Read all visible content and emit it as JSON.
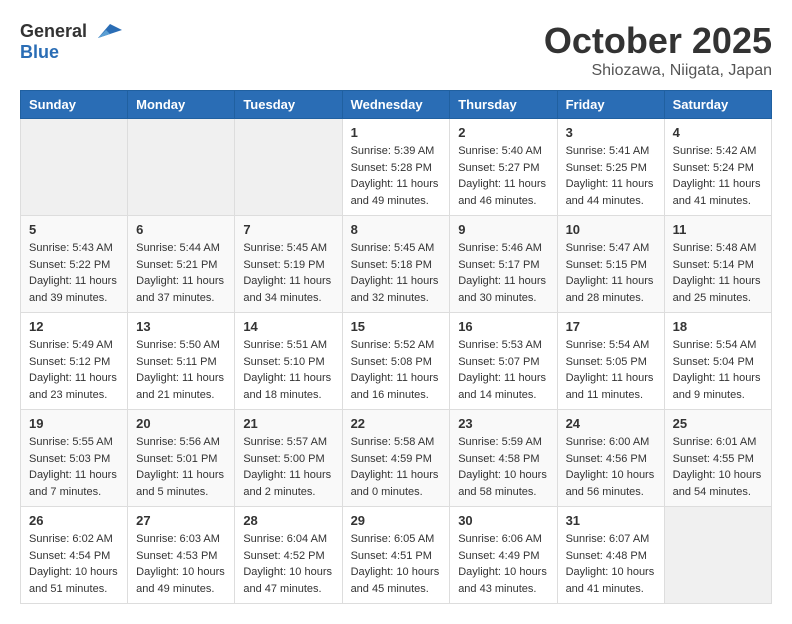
{
  "header": {
    "logo_general": "General",
    "logo_blue": "Blue",
    "month": "October 2025",
    "location": "Shiozawa, Niigata, Japan"
  },
  "days_of_week": [
    "Sunday",
    "Monday",
    "Tuesday",
    "Wednesday",
    "Thursday",
    "Friday",
    "Saturday"
  ],
  "weeks": [
    [
      {
        "day": "",
        "info": ""
      },
      {
        "day": "",
        "info": ""
      },
      {
        "day": "",
        "info": ""
      },
      {
        "day": "1",
        "info": "Sunrise: 5:39 AM\nSunset: 5:28 PM\nDaylight: 11 hours\nand 49 minutes."
      },
      {
        "day": "2",
        "info": "Sunrise: 5:40 AM\nSunset: 5:27 PM\nDaylight: 11 hours\nand 46 minutes."
      },
      {
        "day": "3",
        "info": "Sunrise: 5:41 AM\nSunset: 5:25 PM\nDaylight: 11 hours\nand 44 minutes."
      },
      {
        "day": "4",
        "info": "Sunrise: 5:42 AM\nSunset: 5:24 PM\nDaylight: 11 hours\nand 41 minutes."
      }
    ],
    [
      {
        "day": "5",
        "info": "Sunrise: 5:43 AM\nSunset: 5:22 PM\nDaylight: 11 hours\nand 39 minutes."
      },
      {
        "day": "6",
        "info": "Sunrise: 5:44 AM\nSunset: 5:21 PM\nDaylight: 11 hours\nand 37 minutes."
      },
      {
        "day": "7",
        "info": "Sunrise: 5:45 AM\nSunset: 5:19 PM\nDaylight: 11 hours\nand 34 minutes."
      },
      {
        "day": "8",
        "info": "Sunrise: 5:45 AM\nSunset: 5:18 PM\nDaylight: 11 hours\nand 32 minutes."
      },
      {
        "day": "9",
        "info": "Sunrise: 5:46 AM\nSunset: 5:17 PM\nDaylight: 11 hours\nand 30 minutes."
      },
      {
        "day": "10",
        "info": "Sunrise: 5:47 AM\nSunset: 5:15 PM\nDaylight: 11 hours\nand 28 minutes."
      },
      {
        "day": "11",
        "info": "Sunrise: 5:48 AM\nSunset: 5:14 PM\nDaylight: 11 hours\nand 25 minutes."
      }
    ],
    [
      {
        "day": "12",
        "info": "Sunrise: 5:49 AM\nSunset: 5:12 PM\nDaylight: 11 hours\nand 23 minutes."
      },
      {
        "day": "13",
        "info": "Sunrise: 5:50 AM\nSunset: 5:11 PM\nDaylight: 11 hours\nand 21 minutes."
      },
      {
        "day": "14",
        "info": "Sunrise: 5:51 AM\nSunset: 5:10 PM\nDaylight: 11 hours\nand 18 minutes."
      },
      {
        "day": "15",
        "info": "Sunrise: 5:52 AM\nSunset: 5:08 PM\nDaylight: 11 hours\nand 16 minutes."
      },
      {
        "day": "16",
        "info": "Sunrise: 5:53 AM\nSunset: 5:07 PM\nDaylight: 11 hours\nand 14 minutes."
      },
      {
        "day": "17",
        "info": "Sunrise: 5:54 AM\nSunset: 5:05 PM\nDaylight: 11 hours\nand 11 minutes."
      },
      {
        "day": "18",
        "info": "Sunrise: 5:54 AM\nSunset: 5:04 PM\nDaylight: 11 hours\nand 9 minutes."
      }
    ],
    [
      {
        "day": "19",
        "info": "Sunrise: 5:55 AM\nSunset: 5:03 PM\nDaylight: 11 hours\nand 7 minutes."
      },
      {
        "day": "20",
        "info": "Sunrise: 5:56 AM\nSunset: 5:01 PM\nDaylight: 11 hours\nand 5 minutes."
      },
      {
        "day": "21",
        "info": "Sunrise: 5:57 AM\nSunset: 5:00 PM\nDaylight: 11 hours\nand 2 minutes."
      },
      {
        "day": "22",
        "info": "Sunrise: 5:58 AM\nSunset: 4:59 PM\nDaylight: 11 hours\nand 0 minutes."
      },
      {
        "day": "23",
        "info": "Sunrise: 5:59 AM\nSunset: 4:58 PM\nDaylight: 10 hours\nand 58 minutes."
      },
      {
        "day": "24",
        "info": "Sunrise: 6:00 AM\nSunset: 4:56 PM\nDaylight: 10 hours\nand 56 minutes."
      },
      {
        "day": "25",
        "info": "Sunrise: 6:01 AM\nSunset: 4:55 PM\nDaylight: 10 hours\nand 54 minutes."
      }
    ],
    [
      {
        "day": "26",
        "info": "Sunrise: 6:02 AM\nSunset: 4:54 PM\nDaylight: 10 hours\nand 51 minutes."
      },
      {
        "day": "27",
        "info": "Sunrise: 6:03 AM\nSunset: 4:53 PM\nDaylight: 10 hours\nand 49 minutes."
      },
      {
        "day": "28",
        "info": "Sunrise: 6:04 AM\nSunset: 4:52 PM\nDaylight: 10 hours\nand 47 minutes."
      },
      {
        "day": "29",
        "info": "Sunrise: 6:05 AM\nSunset: 4:51 PM\nDaylight: 10 hours\nand 45 minutes."
      },
      {
        "day": "30",
        "info": "Sunrise: 6:06 AM\nSunset: 4:49 PM\nDaylight: 10 hours\nand 43 minutes."
      },
      {
        "day": "31",
        "info": "Sunrise: 6:07 AM\nSunset: 4:48 PM\nDaylight: 10 hours\nand 41 minutes."
      },
      {
        "day": "",
        "info": ""
      }
    ]
  ]
}
